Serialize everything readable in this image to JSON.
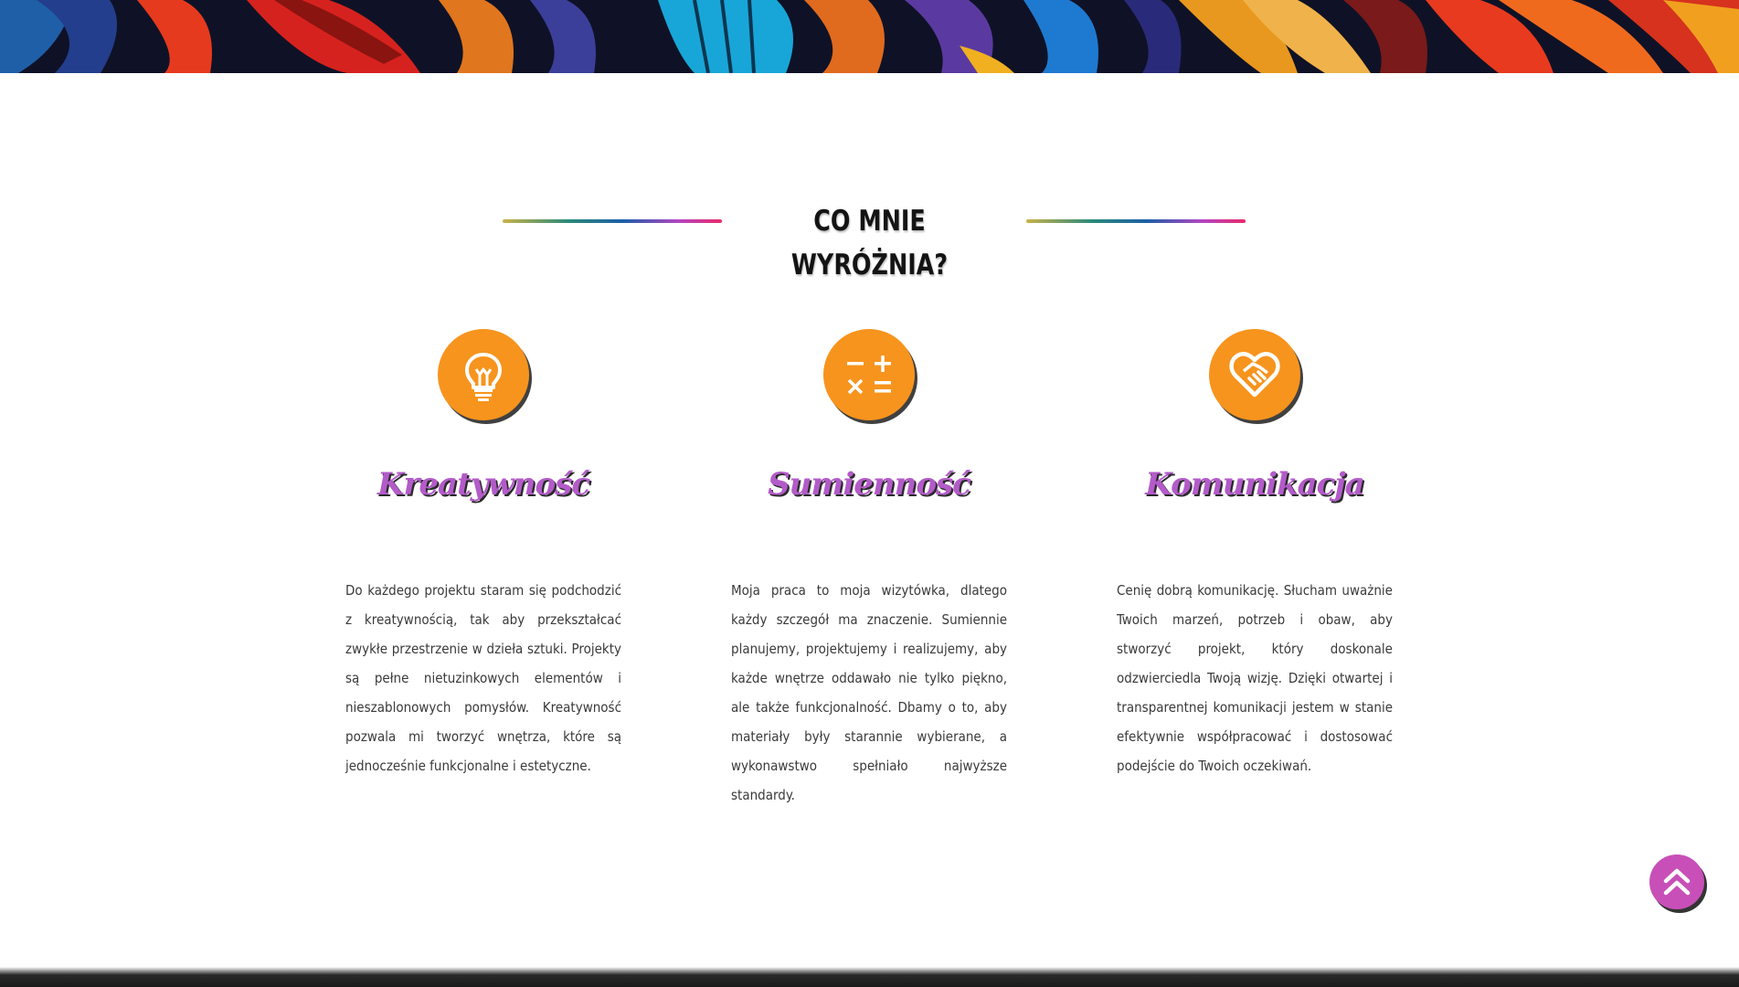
{
  "section": {
    "heading": "CO MNIE WYRÓŻNIA?"
  },
  "features": [
    {
      "icon": "lightbulb-icon",
      "title": "Kreatywność",
      "text": "Do każdego projektu staram się podchodzić z kreatywnością, tak aby przekształcać zwykłe przestrzenie w dzieła sztuki. Projekty są pełne nietuzinkowych elementów i nieszablonowych pomysłów. Kreatywność pozwala mi tworzyć wnętrza, które są jednocześnie funkcjonalne i estetyczne."
    },
    {
      "icon": "calculator-symbols-icon",
      "title": "Sumienność",
      "text": "Moja praca to moja wizytówka, dlatego każdy szczegół ma znaczenie. Sumiennie planujemy, projektujemy i realizujemy, aby każde wnętrze oddawało nie tylko piękno, ale także funkcjonalność. Dbamy o to, aby materiały były starannie wybierane, a wykonawstwo spełniało najwyższe standardy."
    },
    {
      "icon": "heart-handshake-icon",
      "title": "Komunikacja",
      "text": "Cenię dobrą komunikację. Słucham uważnie Twoich marzeń, potrzeb i obaw, aby stworzyć projekt, który doskonale odzwierciedla Twoją wizję. Dzięki otwartej i transparentnej komunikacji jestem w stanie efektywnie współpracować i dostosować podejście do Twoich oczekiwań."
    }
  ],
  "scroll_top": {
    "icon": "double-chevron-up-icon"
  },
  "colors": {
    "accent_orange": "#f7941d",
    "accent_purple": "#b35bc9",
    "scroll_button": "#c84fb8",
    "heading_text": "#141414"
  }
}
